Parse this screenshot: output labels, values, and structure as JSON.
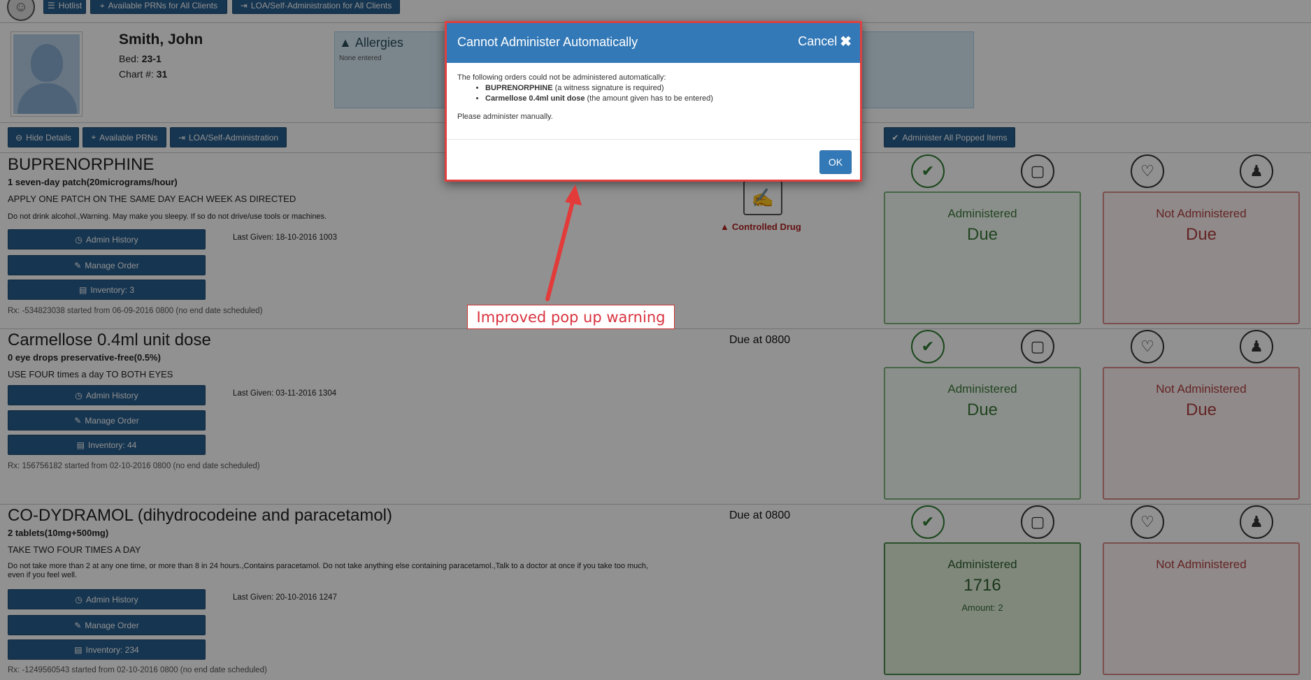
{
  "topbar": {
    "buttons": [
      {
        "label": "Hotlist",
        "icon": "list-icon"
      },
      {
        "label": "Available PRNs for All Clients",
        "icon": "tag-icon"
      },
      {
        "label": "LOA/Self-Administration for All Clients",
        "icon": "sign-out-icon"
      }
    ]
  },
  "patient": {
    "name": "Smith, John",
    "bed_label": "Bed:",
    "bed": "23-1",
    "chart_label": "Chart #:",
    "chart": "31"
  },
  "allergies": {
    "title": "Allergies",
    "value": "None entered"
  },
  "actions": {
    "hide_details": "Hide Details",
    "available_prns": "Available PRNs",
    "loa": "LOA/Self-Administration",
    "administer_all": "Administer All Popped Items"
  },
  "orders": [
    {
      "name": "BUPRENORPHINE",
      "dose": "1 seven-day patch(20micrograms/hour)",
      "instructions": "APPLY ONE PATCH ON THE SAME DAY EACH WEEK AS DIRECTED",
      "warning": "Do not drink alcohol.,Warning. May make you sleepy. If so do not drive/use tools or machines.",
      "admin_history": "Admin History",
      "manage_order": "Manage Order",
      "inventory": "Inventory: 3",
      "last_given": "Last Given: 18-10-2016 1003",
      "rx": "Rx: -534823038 started from 06-09-2016 0800 (no end date scheduled)",
      "status": "Controlled Drug",
      "administered_title": "Administered",
      "administered_value": "Due",
      "administered_amount": "",
      "not_administered_title": "Not Administered",
      "not_administered_value": "Due"
    },
    {
      "name": "Carmellose 0.4ml unit dose",
      "dose": "0 eye drops preservative-free(0.5%)",
      "instructions": "USE FOUR times a day TO BOTH EYES",
      "warning": "",
      "admin_history": "Admin History",
      "manage_order": "Manage Order",
      "inventory": "Inventory: 44",
      "last_given": "Last Given: 03-11-2016 1304",
      "rx": "Rx: 156756182 started from 02-10-2016 0800 (no end date scheduled)",
      "status": "Due at 0800",
      "administered_title": "Administered",
      "administered_value": "Due",
      "administered_amount": "",
      "not_administered_title": "Not Administered",
      "not_administered_value": "Due"
    },
    {
      "name": "CO-DYDRAMOL (dihydrocodeine and paracetamol)",
      "dose": "2 tablets(10mg+500mg)",
      "instructions": "TAKE TWO FOUR TIMES A DAY",
      "warning": "Do not take more than 2 at any one time, or more than 8 in 24 hours.,Contains paracetamol. Do not take anything else containing paracetamol.,Talk to a doctor at once if you take too much, even if you feel well.",
      "admin_history": "Admin History",
      "manage_order": "Manage Order",
      "inventory": "Inventory: 234",
      "last_given": "Last Given: 20-10-2016 1247",
      "rx": "Rx: -1249560543 started from 02-10-2016 0800 (no end date scheduled)",
      "status": "Due at 0800",
      "administered_title": "Administered",
      "administered_value": "1716",
      "administered_amount": "Amount: 2",
      "not_administered_title": "Not Administered",
      "not_administered_value": ""
    }
  ],
  "modal": {
    "title": "Cannot Administer Automatically",
    "cancel": "Cancel",
    "intro": "The following orders could not be administered automatically:",
    "items": [
      {
        "drug": "BUPRENORPHINE",
        "reason": "(a witness signature is required)"
      },
      {
        "drug": "Carmellose 0.4ml unit dose",
        "reason": "(the amount given has to be entered)"
      }
    ],
    "footer_text": "Please administer manually.",
    "ok": "OK"
  },
  "annotation": {
    "text": "Improved pop up warning",
    "color": "#d9333f"
  }
}
